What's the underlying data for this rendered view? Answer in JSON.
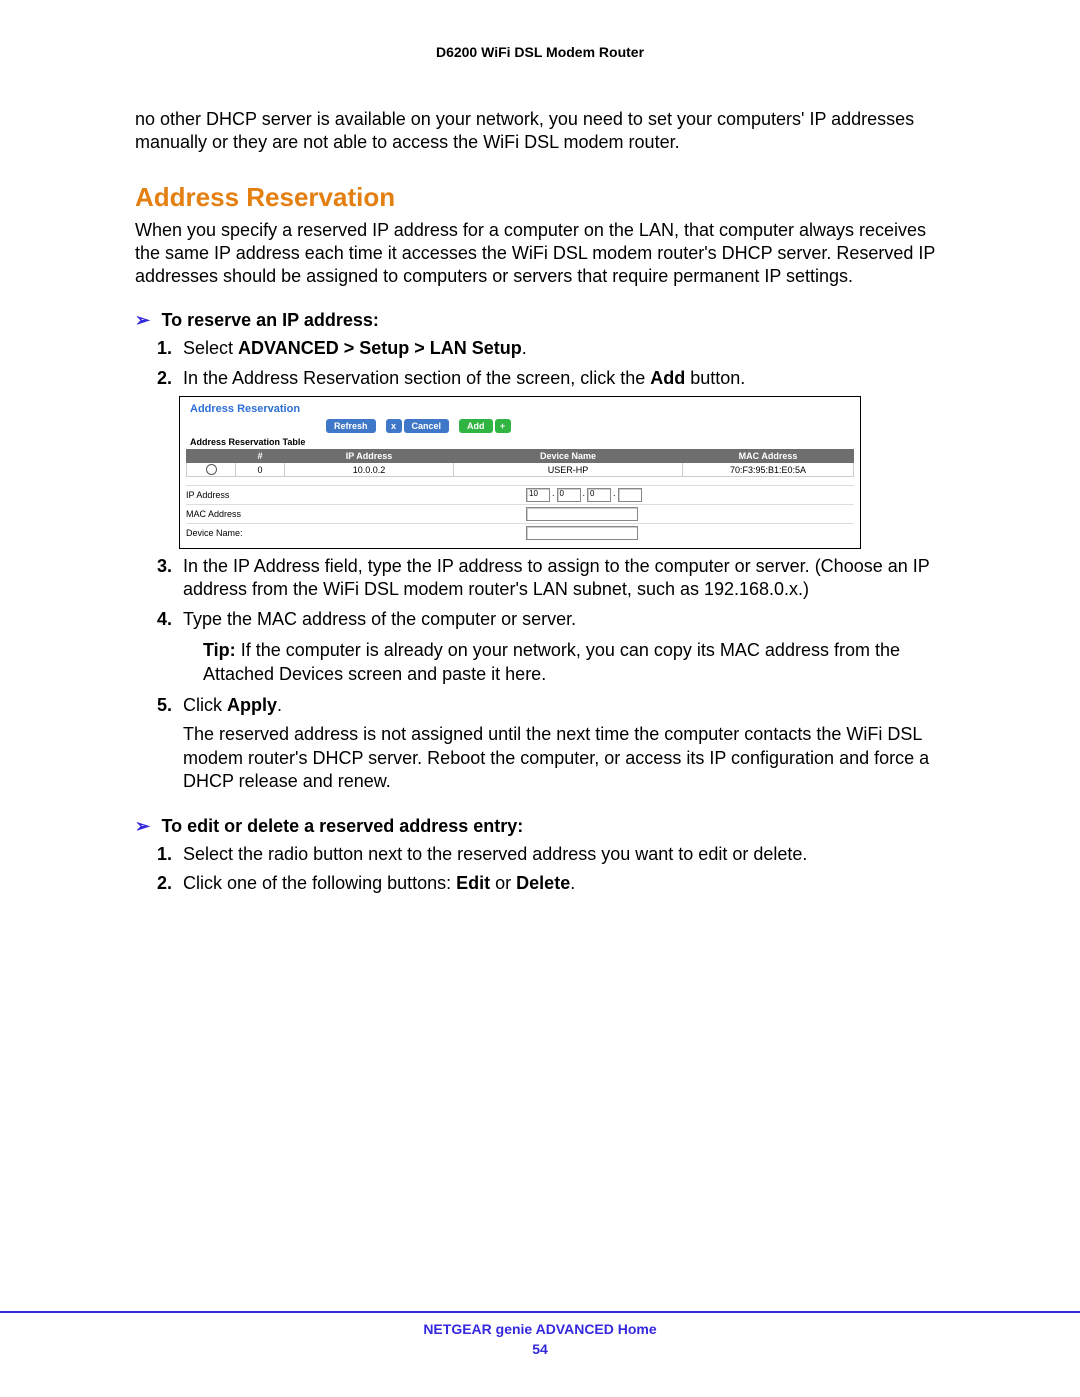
{
  "header": {
    "product": "D6200 WiFi DSL Modem Router"
  },
  "lead_para": "no other DHCP server is available on your network, you need to set your computers' IP addresses manually or they are not able to access the WiFi DSL modem router.",
  "section_title": "Address Reservation",
  "section_intro": "When you specify a reserved IP address for a computer on the LAN, that computer always receives the same IP address each time it accesses the WiFi DSL modem router's DHCP server. Reserved IP addresses should be assigned to computers or servers that require permanent IP settings.",
  "task1_heading": "To reserve an IP address:",
  "step1": {
    "prefix": "Select ",
    "bold": "ADVANCED > Setup > LAN Setup",
    "suffix": "."
  },
  "step2": {
    "prefix": "In the Address Reservation section of the screen, click the ",
    "bold": "Add",
    "suffix": " button."
  },
  "screenshot": {
    "title": "Address Reservation",
    "buttons": {
      "refresh": "Refresh",
      "cancel": "Cancel",
      "cancel_x": "x",
      "add": "Add",
      "add_plus": "+"
    },
    "table_caption": "Address Reservation Table",
    "columns": {
      "num": "#",
      "ip": "IP Address",
      "device": "Device Name",
      "mac": "MAC Address"
    },
    "row": {
      "num": "0",
      "ip": "10.0.0.2",
      "device": "USER-HP",
      "mac": "70:F3:95:B1:E0:5A"
    },
    "form": {
      "ip_label": "IP Address",
      "mac_label": "MAC Address",
      "device_label": "Device Name:",
      "ip_octets": [
        "10",
        "0",
        "0",
        ""
      ]
    }
  },
  "step3": "In the IP Address field, type the IP address to assign to the computer or server. (Choose an IP address from the WiFi DSL modem router's LAN subnet, such as 192.168.0.x.)",
  "step4": "Type the MAC address of the computer or server.",
  "tip": {
    "label": "Tip:",
    "text": "If the computer is already on your network, you can copy its MAC address from the Attached Devices screen and paste it here."
  },
  "step5": {
    "prefix": "Click ",
    "bold": "Apply",
    "suffix": "."
  },
  "step5_body": "The reserved address is not assigned until the next time the computer contacts the WiFi DSL modem router's DHCP server. Reboot the computer, or access its IP configuration and force a DHCP release and renew.",
  "task2_heading": "To edit or delete a reserved address entry:",
  "t2_step1": "Select the radio button next to the reserved address you want to edit or delete.",
  "t2_step2": {
    "prefix": "Click one of the following buttons: ",
    "b1": "Edit",
    "mid": " or ",
    "b2": "Delete",
    "suffix": "."
  },
  "footer": {
    "line": "NETGEAR genie ADVANCED Home",
    "page": "54"
  }
}
